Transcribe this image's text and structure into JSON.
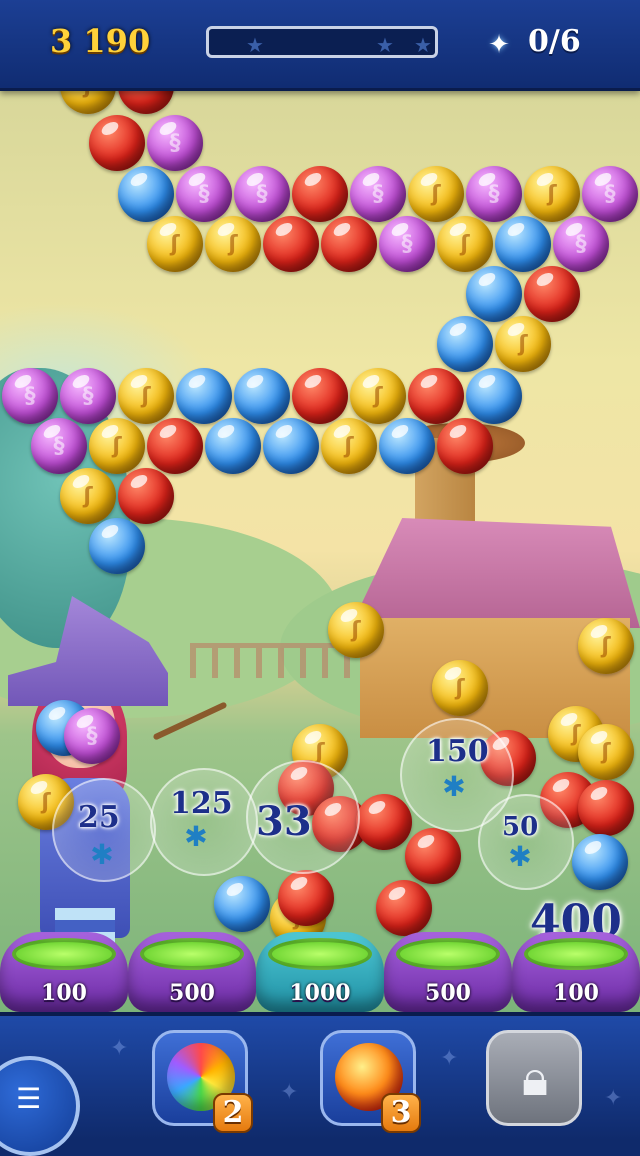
{
  "hud": {
    "score": "3 190",
    "progress_fraction": 0.0,
    "stars_collected": "0/6",
    "star_icon": "star-icon"
  },
  "field": {
    "spider_labels": [
      "25",
      "125",
      "33",
      "150",
      "50"
    ],
    "popup_score": "400",
    "cauldrons": [
      {
        "value": "100",
        "color": "#8a45c4"
      },
      {
        "value": "500",
        "color": "#8a45c4"
      },
      {
        "value": "1000",
        "color": "#2aa7b8"
      },
      {
        "value": "500",
        "color": "#8a45c4"
      },
      {
        "value": "100",
        "color": "#8a45c4"
      }
    ]
  },
  "boosters": [
    {
      "name": "rainbow-bubble",
      "count": "2"
    },
    {
      "name": "fire-bubble",
      "count": "3"
    },
    {
      "name": "locked-slot",
      "locked": true
    }
  ],
  "colors": {
    "red": "#e0231a",
    "yellow": "#f6b90c",
    "purple": "#c24ed8",
    "blue": "#2f8ff0"
  }
}
